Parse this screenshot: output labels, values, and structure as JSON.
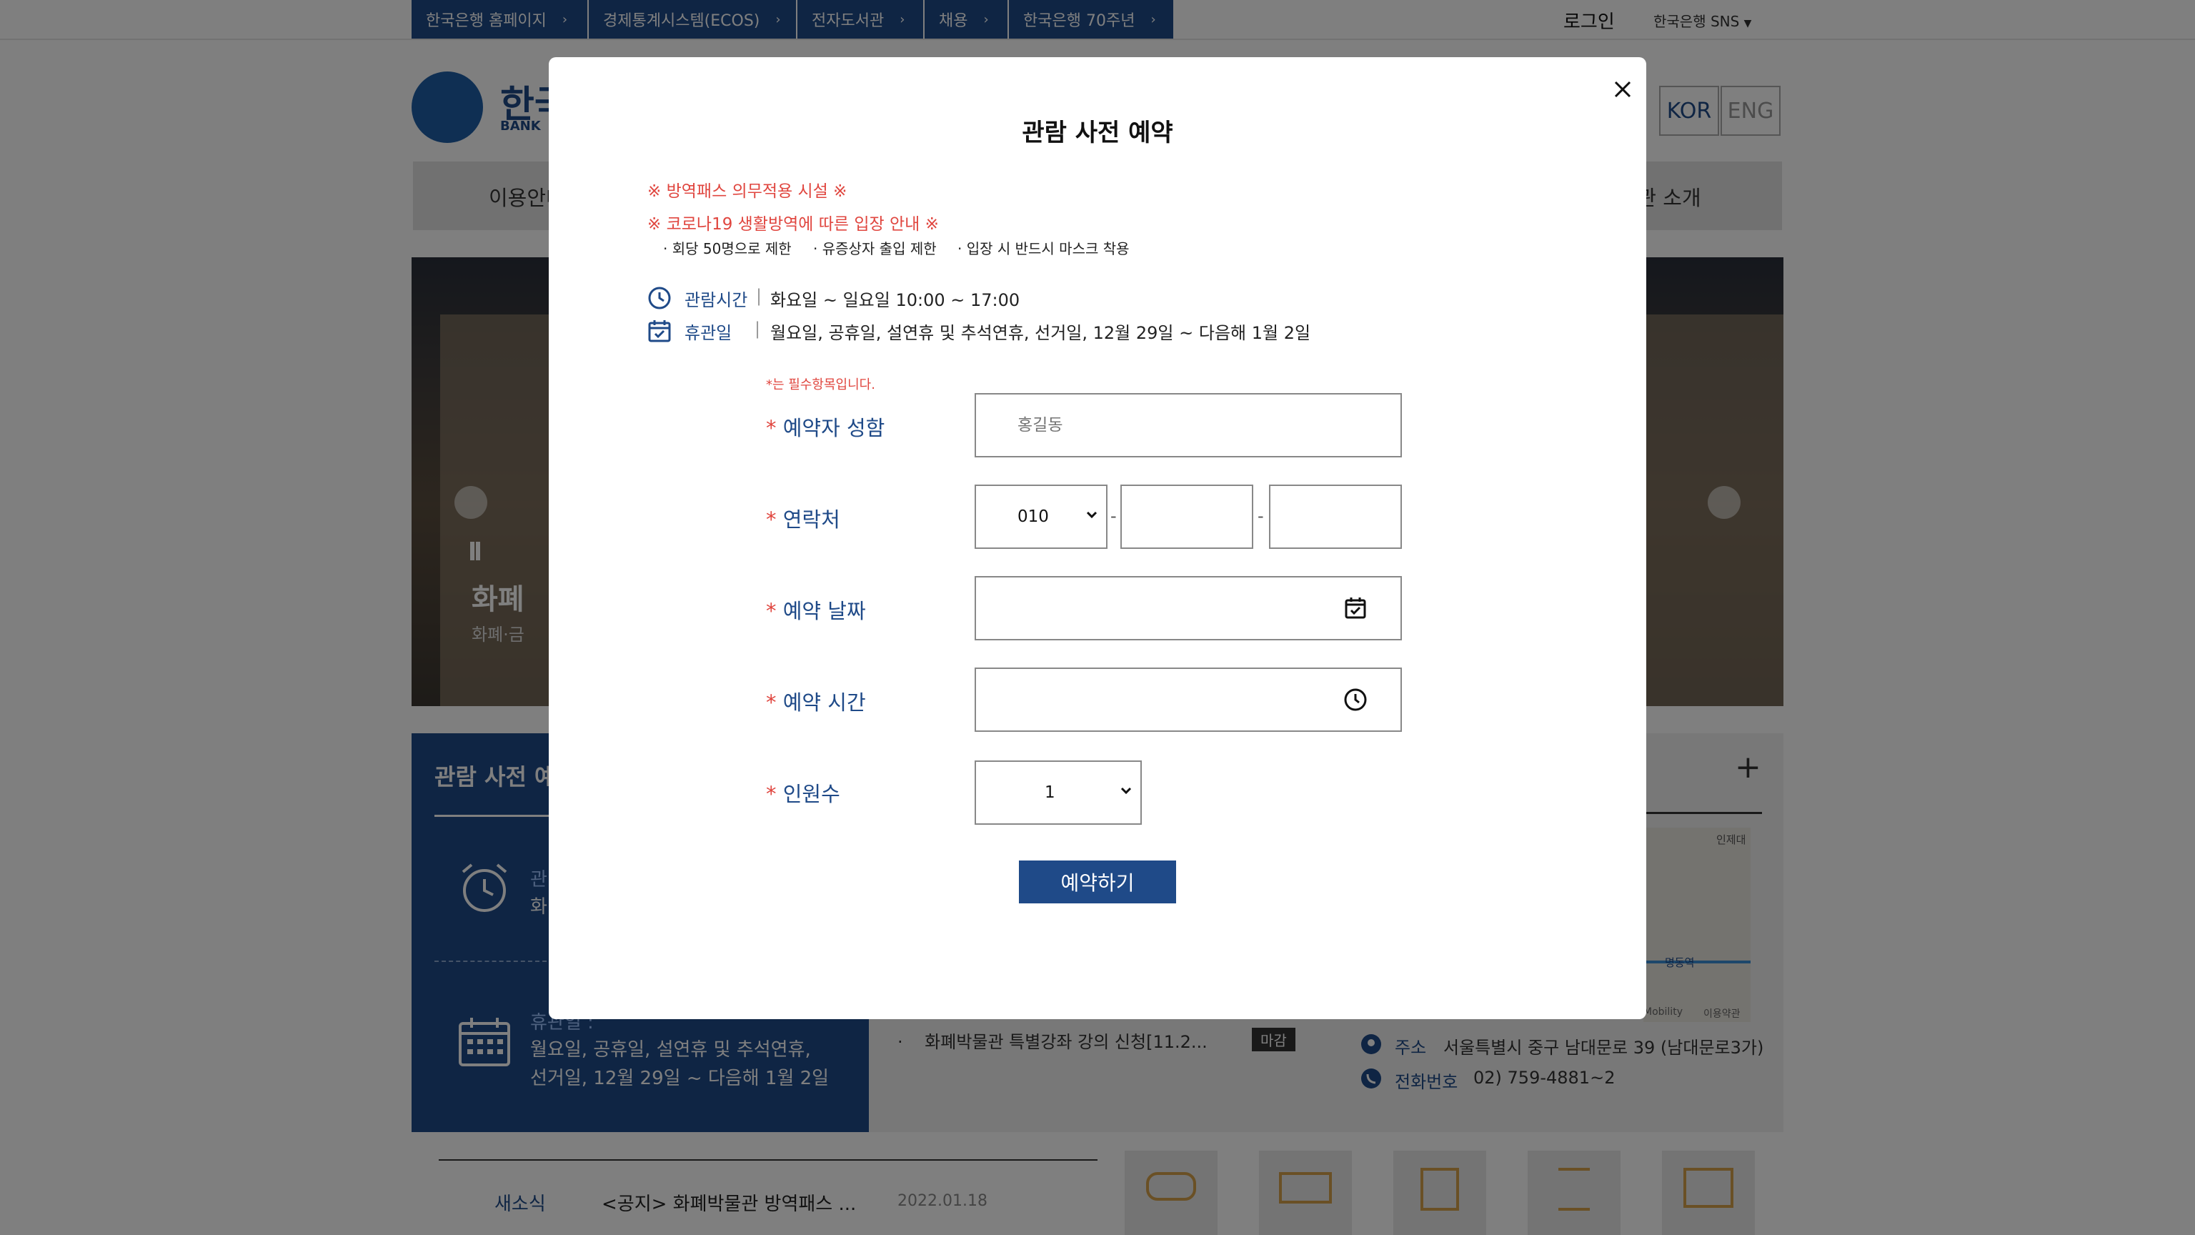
{
  "top_nav": {
    "links": [
      "한국은행 홈페이지",
      "경제통계시스템(ECOS)",
      "전자도서관",
      "채용",
      "한국은행 70주년"
    ],
    "login": "로그인",
    "sns": "한국은행 SNS"
  },
  "lang": {
    "kor": "KOR",
    "eng": "ENG"
  },
  "logo": {
    "text": "한국",
    "sub": "BANK"
  },
  "main_nav": {
    "left": "이용안내",
    "right": "박물관 소개"
  },
  "banner": {
    "title": "화폐",
    "subtitle": "화폐·금"
  },
  "reservation_card": {
    "title": "관람 사전 예",
    "hours_label": "관",
    "hours_value": "화",
    "closed_label": "휴관일 :",
    "closed_line1": "월요일, 공휴일, 설연휴 및 추석연휴,",
    "closed_line2": "선거일, 12월 29일 ~ 다음해 1월 2일"
  },
  "notice_item": {
    "text": "화폐박물관 특별강좌 강의 신청[11.2...",
    "badge": "마감"
  },
  "location": {
    "plus": "+",
    "address_label": "주소",
    "address_value": "서울특별시 중구 남대문로 39 (남대문로3가)",
    "phone_label": "전화번호",
    "phone_value": "02) 759-4881~2",
    "map_labels": [
      "인제대",
      "명동역",
      "Mobility",
      "이용약관"
    ]
  },
  "news": {
    "label": "새소식",
    "text": "<공지> 화폐박물관 방역패스 ...",
    "date": "2022.01.18"
  },
  "quick_icons": [
    "ticket-icon",
    "money-icon",
    "book-icon",
    "hourglass-icon",
    "bank-icon"
  ],
  "modal": {
    "title": "관람 사전 예약",
    "notice1": "※ 방역패스 의무적용 시설 ※",
    "notice2": "※ 코로나19 생활방역에 따른 입장 안내 ※",
    "rules": [
      "· 회당 50명으로 제한",
      "· 유증상자 출입 제한",
      "· 입장 시 반드시 마스크 착용"
    ],
    "hours_label": "관람시간",
    "hours_value": "화요일 ~ 일요일 10:00 ~ 17:00",
    "closed_label": "휴관일",
    "closed_value": "월요일, 공휴일, 설연휴 및 추석연휴, 선거일, 12월 29일 ~ 다음해 1월 2일",
    "required_note": "*는 필수항목입니다.",
    "form": {
      "name_label": "예약자 성함",
      "name_placeholder": "홍길동",
      "phone_label": "연락처",
      "phone_prefix": "010",
      "date_label": "예약 날짜",
      "time_label": "예약 시간",
      "count_label": "인원수",
      "count_value": "1",
      "required_mark": "*",
      "separator": "-"
    },
    "submit": "예약하기"
  },
  "colors": {
    "primary": "#1f4a88",
    "accent_red": "#e0463f"
  }
}
